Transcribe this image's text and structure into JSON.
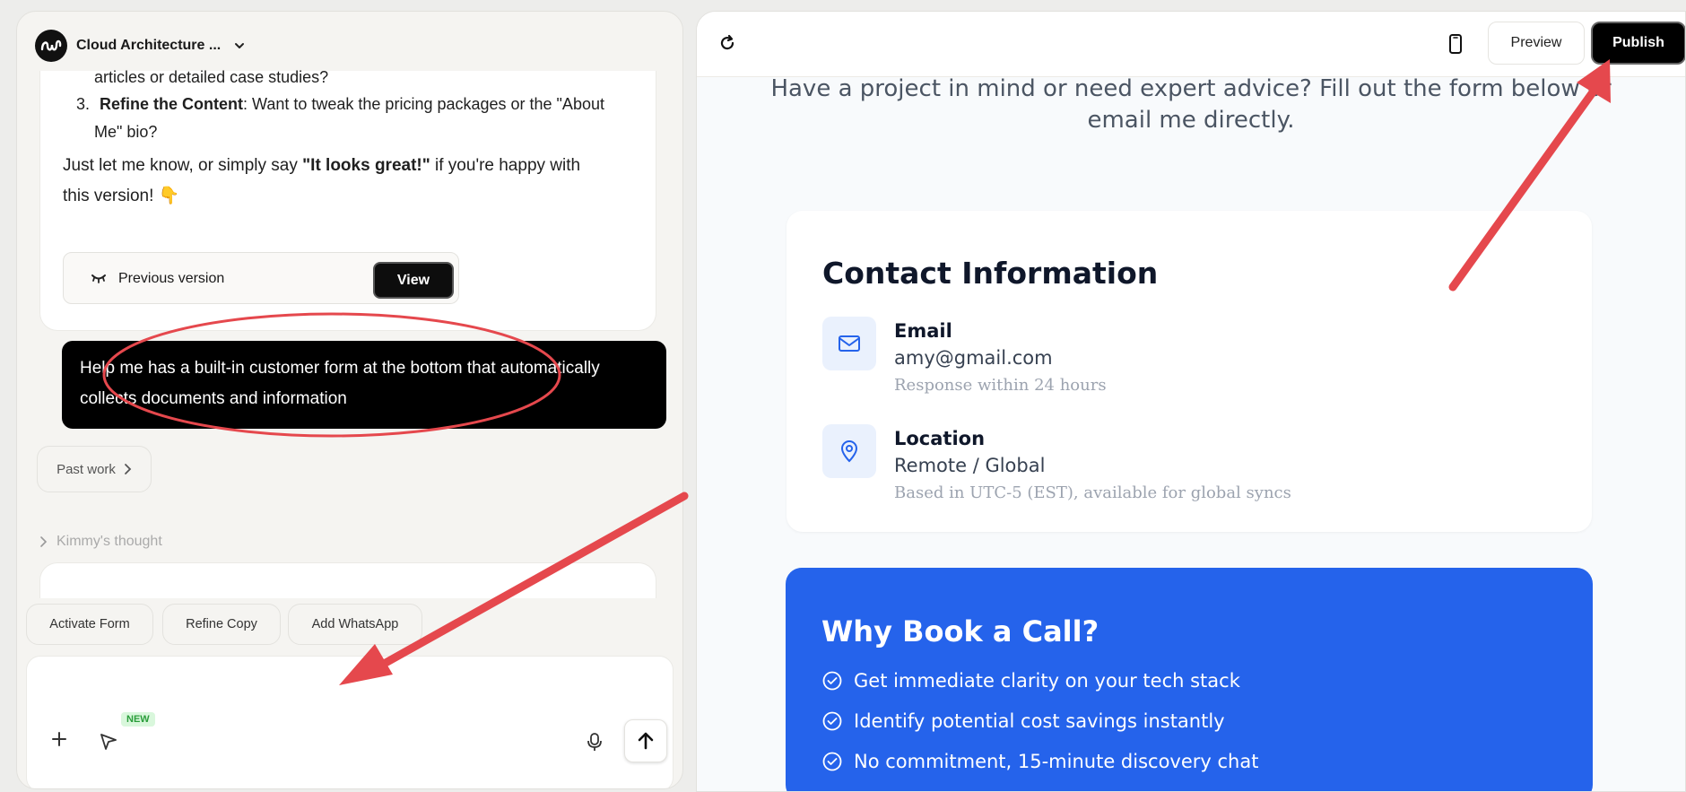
{
  "chat": {
    "project_title": "Cloud Architecture ...",
    "ai_message": {
      "line1": "articles or detailed case studies?",
      "item3_number": "3.",
      "item3_bold": "Refine the Content",
      "item3_text": ": Want to tweak the pricing packages or the \"About",
      "item3_line2": "Me\" bio?",
      "closing_line1_pre": "Just let me know, or simply say ",
      "closing_line1_bold": "\"It looks great!\"",
      "closing_line1_post": " if you're happy with",
      "closing_line2": "this version! 👇"
    },
    "previous_version_label": "Previous version",
    "view_button": "View",
    "user_message_line1": "Help me has a built-in customer form at the bottom that automatically",
    "user_message_line2": "collects documents and information",
    "past_work_label": "Past work",
    "thought_label": "Kimmy's thought",
    "suggestions": [
      "Activate Form",
      "Refine Copy",
      "Add WhatsApp"
    ],
    "input": {
      "placeholder": "",
      "new_badge": "NEW"
    }
  },
  "preview": {
    "toolbar": {
      "preview_label": "Preview",
      "publish_label": "Publish"
    },
    "intro_line1": "Have a project in mind or need expert advice? Fill out the form below or",
    "intro_line2": "email me directly.",
    "contact": {
      "heading": "Contact Information",
      "items": [
        {
          "title": "Email",
          "value": "amy@gmail.com",
          "sub": "Response within 24 hours",
          "icon": "mail-icon"
        },
        {
          "title": "Location",
          "value": "Remote / Global",
          "sub": "Based in UTC-5 (EST), available for global syncs",
          "icon": "map-pin-icon"
        }
      ]
    },
    "why": {
      "heading": "Why Book a Call?",
      "items": [
        "Get immediate clarity on your tech stack",
        "Identify potential cost savings instantly",
        "No commitment, 15-minute discovery chat"
      ]
    }
  },
  "colors": {
    "accent_blue": "#2563eb",
    "annotation_red": "#e5484d",
    "icon_bg": "#eaf1fd"
  }
}
